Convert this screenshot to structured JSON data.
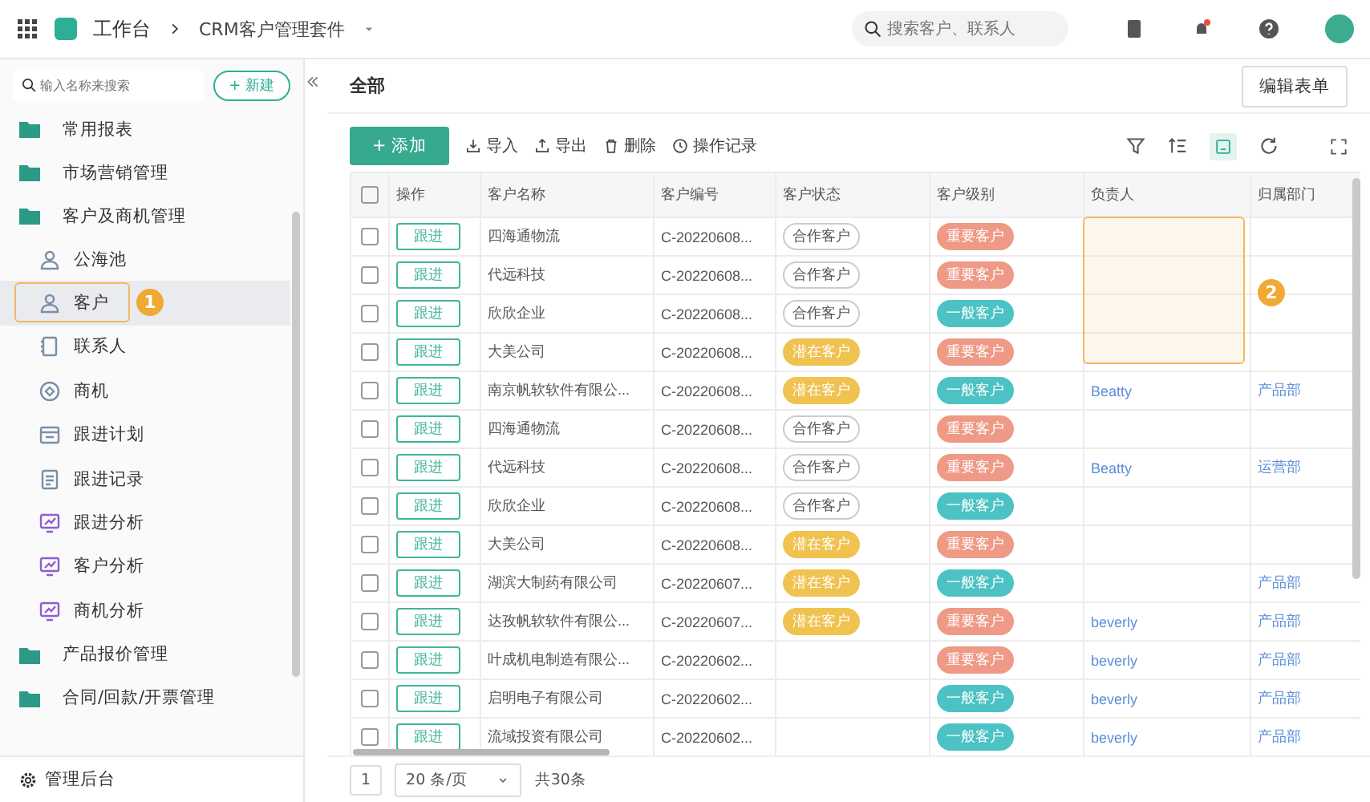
{
  "topbar": {
    "app": "工作台",
    "suite": "CRM客户管理套件",
    "search": {
      "placeholder": "搜索客户、联系人"
    }
  },
  "sidebar": {
    "search": {
      "placeholder": "输入名称来搜索"
    },
    "new_button": "+ 新建",
    "items": [
      {
        "label": "常用报表"
      },
      {
        "label": "市场营销管理"
      },
      {
        "label": "客户及商机管理",
        "children": [
          {
            "label": "公海池",
            "kind": "person",
            "selected": false
          },
          {
            "label": "客户",
            "kind": "person",
            "selected": true
          },
          {
            "label": "联系人",
            "kind": "contact",
            "selected": false
          },
          {
            "label": "商机",
            "kind": "target",
            "selected": false
          },
          {
            "label": "跟进计划",
            "kind": "calendar",
            "selected": false
          },
          {
            "label": "跟进记录",
            "kind": "doc",
            "selected": false
          },
          {
            "label": "跟进分析",
            "kind": "chart",
            "selected": false
          },
          {
            "label": "客户分析",
            "kind": "chart",
            "selected": false
          },
          {
            "label": "商机分析",
            "kind": "chart",
            "selected": false
          }
        ]
      },
      {
        "label": "产品报价管理"
      },
      {
        "label": "合同/回款/开票管理"
      }
    ],
    "footer": "管理后台"
  },
  "view": {
    "title": "全部",
    "edit_button": "编辑表单",
    "add_button": "+ 添加",
    "actions": [
      "导入",
      "导出",
      "删除",
      "操作记录"
    ]
  },
  "table": {
    "select_all_checked": false,
    "columns": [
      "操作",
      "客户名称",
      "客户编号",
      "客户状态",
      "客户级别",
      "负责人",
      "归属部门"
    ],
    "rows": [
      {
        "checked": false,
        "action": "跟进",
        "name": "四海通物流",
        "code": "C-20220608...",
        "status": {
          "text": "合作客户",
          "color": "#ffffff"
        },
        "level": {
          "text": "重要客户",
          "color": "#ee9a86"
        },
        "owner": "",
        "dept": ""
      },
      {
        "checked": false,
        "action": "跟进",
        "name": "代远科技",
        "code": "C-20220608...",
        "status": {
          "text": "合作客户",
          "color": "#ffffff"
        },
        "level": {
          "text": "重要客户",
          "color": "#ee9a86"
        },
        "owner": "",
        "dept": ""
      },
      {
        "checked": false,
        "action": "跟进",
        "name": "欣欣企业",
        "code": "C-20220608...",
        "status": {
          "text": "合作客户",
          "color": "#ffffff"
        },
        "level": {
          "text": "一般客户",
          "color": "#4cc2c4"
        },
        "owner": "",
        "dept": ""
      },
      {
        "checked": false,
        "action": "跟进",
        "name": "大美公司",
        "code": "C-20220608...",
        "status": {
          "text": "潜在客户",
          "color": "#f0c24f"
        },
        "level": {
          "text": "重要客户",
          "color": "#ee9a86"
        },
        "owner": "",
        "dept": ""
      },
      {
        "checked": false,
        "action": "跟进",
        "name": "南京帆软软件有限公...",
        "code": "C-20220608...",
        "status": {
          "text": "潜在客户",
          "color": "#f0c24f"
        },
        "level": {
          "text": "一般客户",
          "color": "#4cc2c4"
        },
        "owner": "Beatty",
        "dept": "产品部"
      },
      {
        "checked": false,
        "action": "跟进",
        "name": "四海通物流",
        "code": "C-20220608...",
        "status": {
          "text": "合作客户",
          "color": "#ffffff"
        },
        "level": {
          "text": "重要客户",
          "color": "#ee9a86"
        },
        "owner": "",
        "dept": ""
      },
      {
        "checked": false,
        "action": "跟进",
        "name": "代远科技",
        "code": "C-20220608...",
        "status": {
          "text": "合作客户",
          "color": "#ffffff"
        },
        "level": {
          "text": "重要客户",
          "color": "#ee9a86"
        },
        "owner": "Beatty",
        "dept": "运营部"
      },
      {
        "checked": false,
        "action": "跟进",
        "name": "欣欣企业",
        "code": "C-20220608...",
        "status": {
          "text": "合作客户",
          "color": "#ffffff"
        },
        "level": {
          "text": "一般客户",
          "color": "#4cc2c4"
        },
        "owner": "",
        "dept": ""
      },
      {
        "checked": false,
        "action": "跟进",
        "name": "大美公司",
        "code": "C-20220608...",
        "status": {
          "text": "潜在客户",
          "color": "#f0c24f"
        },
        "level": {
          "text": "重要客户",
          "color": "#ee9a86"
        },
        "owner": "",
        "dept": ""
      },
      {
        "checked": false,
        "action": "跟进",
        "name": "湖滨大制药有限公司",
        "code": "C-20220607...",
        "status": {
          "text": "潜在客户",
          "color": "#f0c24f"
        },
        "level": {
          "text": "一般客户",
          "color": "#4cc2c4"
        },
        "owner": "",
        "dept": "产品部"
      },
      {
        "checked": false,
        "action": "跟进",
        "name": "达孜帆软软件有限公...",
        "code": "C-20220607...",
        "status": {
          "text": "潜在客户",
          "color": "#f0c24f"
        },
        "level": {
          "text": "重要客户",
          "color": "#ee9a86"
        },
        "owner": "beverly",
        "dept": "产品部"
      },
      {
        "checked": false,
        "action": "跟进",
        "name": "叶成机电制造有限公...",
        "code": "C-20220602...",
        "level": {
          "text": "重要客户",
          "color": "#ee9a86"
        },
        "owner": "beverly",
        "dept": "产品部"
      },
      {
        "checked": false,
        "action": "跟进",
        "name": "启明电子有限公司",
        "code": "C-20220602...",
        "level": {
          "text": "一般客户",
          "color": "#4cc2c4"
        },
        "owner": "beverly",
        "dept": "产品部"
      },
      {
        "checked": false,
        "action": "跟进",
        "name": "流域投资有限公司",
        "code": "C-20220602...",
        "level": {
          "text": "一般客户",
          "color": "#4cc2c4"
        },
        "owner": "beverly",
        "dept": "产品部"
      }
    ]
  },
  "pagination": {
    "page": "1",
    "page_size": "20 条/页",
    "total": "共30条"
  },
  "annotations": [
    {
      "label": "1"
    },
    {
      "label": "2"
    }
  ]
}
